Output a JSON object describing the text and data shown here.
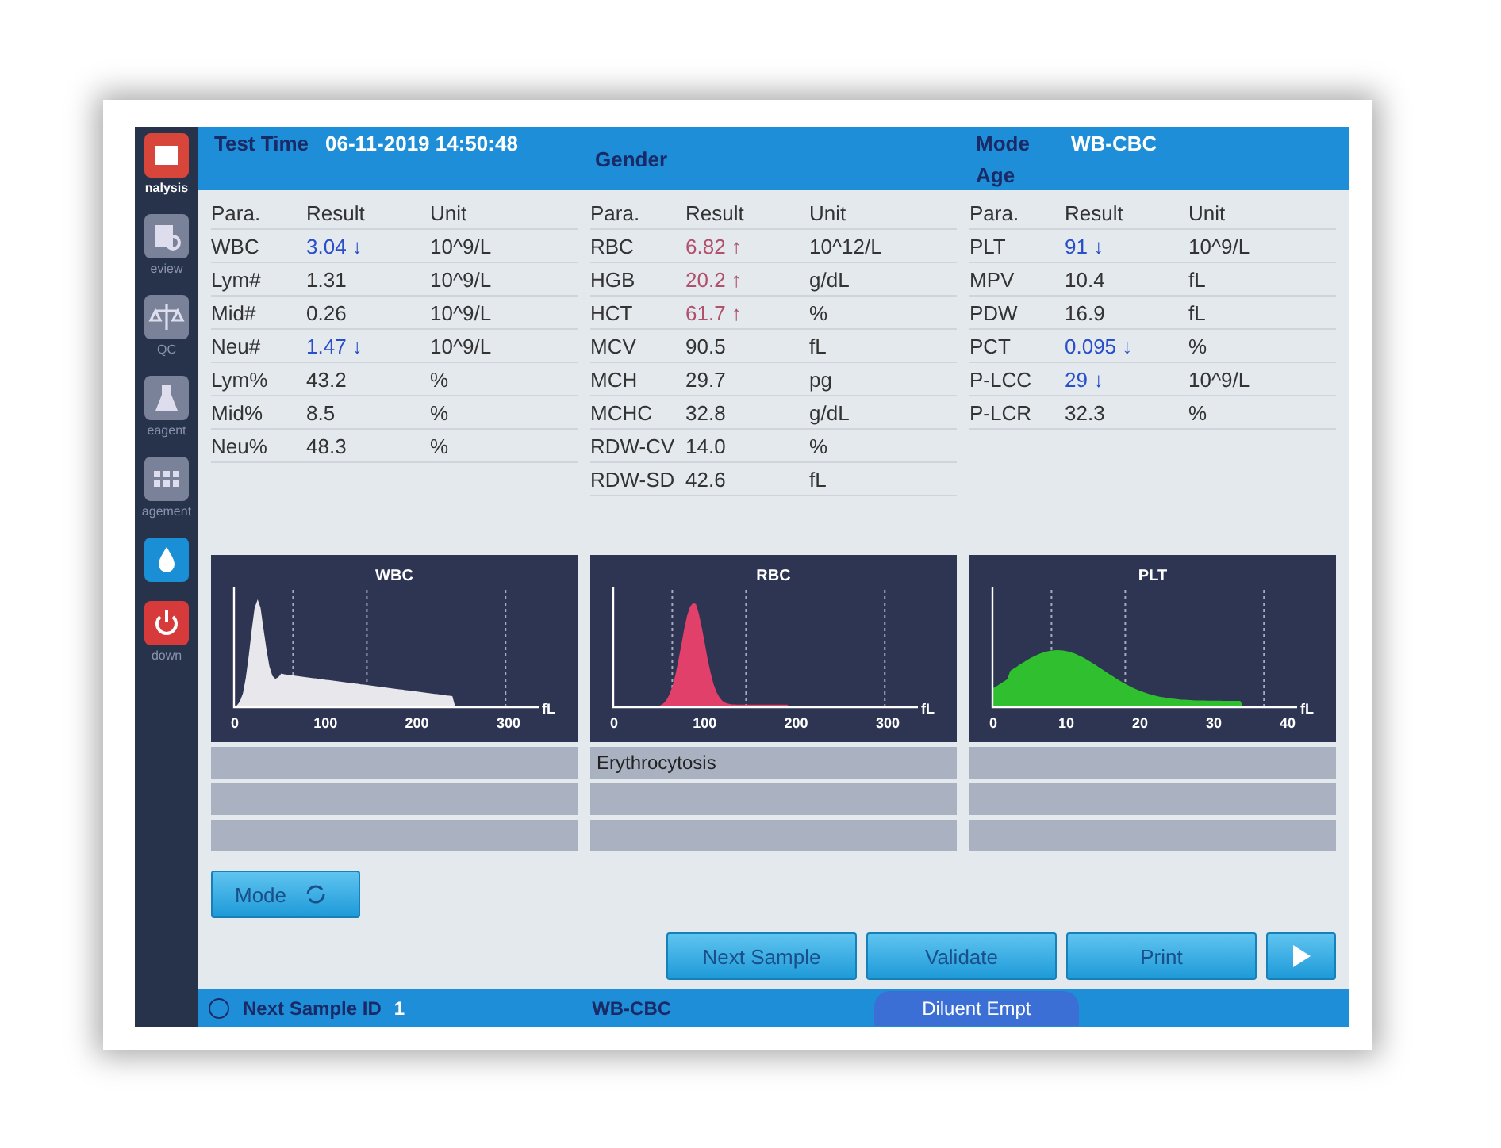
{
  "sidebar": {
    "items": [
      {
        "kind": "analysis",
        "label": "nalysis",
        "selected": true
      },
      {
        "kind": "review",
        "label": "eview",
        "selected": false
      },
      {
        "kind": "qc",
        "label": "QC",
        "selected": false
      },
      {
        "kind": "reagent",
        "label": "eagent",
        "selected": false
      },
      {
        "kind": "management",
        "label": "agement",
        "selected": false
      },
      {
        "kind": "drop",
        "selected": false
      },
      {
        "kind": "shutdown",
        "label": "down",
        "selected": false
      }
    ]
  },
  "header": {
    "test_time_label": "Test Time",
    "test_time": "06-11-2019 14:50:48",
    "gender_label": "Gender",
    "mode_label": "Mode",
    "mode": "WB-CBC",
    "age_label": "Age"
  },
  "groups": [
    {
      "columns": [
        "Para.",
        "Result",
        "Unit"
      ],
      "rows": [
        {
          "para": "WBC",
          "result": "3.04 ↓",
          "unit": "10^9/L",
          "low": true,
          "high": false
        },
        {
          "para": "Lym#",
          "result": "1.31",
          "unit": "10^9/L",
          "low": false,
          "high": false
        },
        {
          "para": "Mid#",
          "result": "0.26",
          "unit": "10^9/L",
          "low": false,
          "high": false
        },
        {
          "para": "Neu#",
          "result": "1.47 ↓",
          "unit": "10^9/L",
          "low": true,
          "high": false
        },
        {
          "para": "Lym%",
          "result": "43.2",
          "unit": "%",
          "low": false,
          "high": false
        },
        {
          "para": "Mid%",
          "result": "8.5",
          "unit": "%",
          "low": false,
          "high": false
        },
        {
          "para": "Neu%",
          "result": "48.3",
          "unit": "%",
          "low": false,
          "high": false
        }
      ]
    },
    {
      "columns": [
        "Para.",
        "Result",
        "Unit"
      ],
      "rows": [
        {
          "para": "RBC",
          "result": "6.82 ↑",
          "unit": "10^12/L",
          "low": false,
          "high": true
        },
        {
          "para": "HGB",
          "result": "20.2 ↑",
          "unit": "g/dL",
          "low": false,
          "high": true
        },
        {
          "para": "HCT",
          "result": "61.7 ↑",
          "unit": "%",
          "low": false,
          "high": true
        },
        {
          "para": "MCV",
          "result": "90.5",
          "unit": "fL",
          "low": false,
          "high": false
        },
        {
          "para": "MCH",
          "result": "29.7",
          "unit": "pg",
          "low": false,
          "high": false
        },
        {
          "para": "MCHC",
          "result": "32.8",
          "unit": "g/dL",
          "low": false,
          "high": false
        },
        {
          "para": "RDW-CV",
          "result": "14.0",
          "unit": "%",
          "low": false,
          "high": false
        },
        {
          "para": "RDW-SD",
          "result": "42.6",
          "unit": "fL",
          "low": false,
          "high": false
        }
      ]
    },
    {
      "columns": [
        "Para.",
        "Result",
        "Unit"
      ],
      "rows": [
        {
          "para": "PLT",
          "result": "91 ↓",
          "unit": "10^9/L",
          "low": true,
          "high": false
        },
        {
          "para": "MPV",
          "result": "10.4",
          "unit": "fL",
          "low": false,
          "high": false
        },
        {
          "para": "PDW",
          "result": "16.9",
          "unit": "fL",
          "low": false,
          "high": false
        },
        {
          "para": "PCT",
          "result": "0.095 ↓",
          "unit": "%",
          "low": true,
          "high": false
        },
        {
          "para": "P-LCC",
          "result": "29 ↓",
          "unit": "10^9/L",
          "low": true,
          "high": false
        },
        {
          "para": "P-LCR",
          "result": "32.3",
          "unit": "%",
          "low": false,
          "high": false
        }
      ]
    }
  ],
  "histograms": [
    {
      "kind": "wbc",
      "title": "WBC",
      "color": "#e8e8ec",
      "ticks": [
        "0",
        "100",
        "200",
        "300"
      ],
      "unit": "fL"
    },
    {
      "kind": "rbc",
      "title": "RBC",
      "color": "#e0406a",
      "ticks": [
        "0",
        "100",
        "200",
        "300"
      ],
      "unit": "fL",
      "flags": [
        "Erythrocytosis"
      ]
    },
    {
      "kind": "plt",
      "title": "PLT",
      "color": "#2fbf2f",
      "ticks": [
        "0",
        "10",
        "20",
        "30",
        "40"
      ],
      "unit": "fL"
    }
  ],
  "mode_button": {
    "label": "Mode"
  },
  "actions": [
    {
      "kind": "text",
      "label": "Next Sample"
    },
    {
      "kind": "text",
      "label": "Validate"
    },
    {
      "kind": "text",
      "label": "Print"
    },
    {
      "kind": "play"
    }
  ],
  "status_bar": {
    "next_id_label": "Next Sample ID",
    "next_id": "1",
    "mode": "WB-CBC",
    "alarm": "Diluent Empt"
  }
}
